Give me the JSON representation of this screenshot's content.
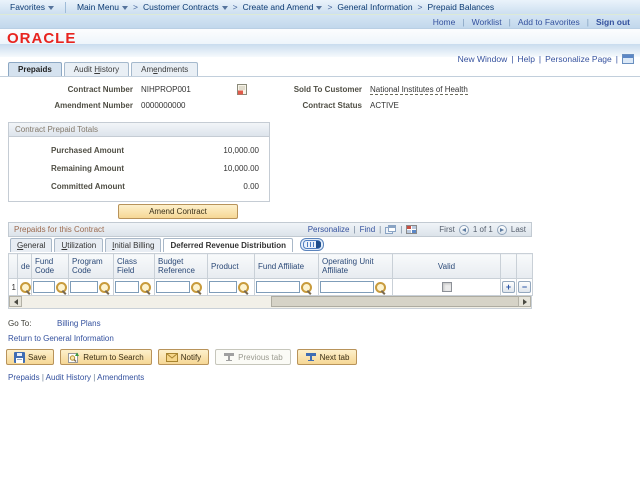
{
  "seps": {
    "pipe": "|",
    "gt": ">"
  },
  "topnav": {
    "favorites": "Favorites",
    "main_menu": "Main Menu",
    "crumbs": [
      "Customer Contracts",
      "Create and Amend",
      "General Information",
      "Prepaid Balances"
    ],
    "quick_links": [
      "Home",
      "Worklist",
      "Add to Favorites",
      "Sign out"
    ]
  },
  "brand": {
    "logo": "ORACLE"
  },
  "page_actions": {
    "links": [
      "New Window",
      "Help",
      "Personalize Page"
    ]
  },
  "page_tabs": {
    "prepaids": "Prepaids",
    "audit_history": {
      "pre": "Audit ",
      "key": "H",
      "post": "istory"
    },
    "amendments": {
      "pre": "Am",
      "key": "e",
      "post": "ndments"
    }
  },
  "fields": {
    "contract_number": {
      "label": "Contract Number",
      "value": "NIHPROP001"
    },
    "amendment_number": {
      "label": "Amendment Number",
      "value": "0000000000"
    },
    "sold_to_customer": {
      "label": "Sold To Customer",
      "value": "National Institutes of Health"
    },
    "contract_status": {
      "label": "Contract Status",
      "value": "ACTIVE"
    }
  },
  "totals": {
    "title": "Contract Prepaid Totals",
    "rows": [
      {
        "label": "Purchased Amount",
        "value": "10,000.00"
      },
      {
        "label": "Remaining Amount",
        "value": "10,000.00"
      },
      {
        "label": "Committed Amount",
        "value": "0.00"
      }
    ]
  },
  "amend_button": "Amend Contract",
  "prepaids_grid": {
    "title": "Prepaids for this Contract",
    "personalize": "Personalize",
    "find": "Find",
    "pagination": {
      "first": "First",
      "counter": "1 of 1",
      "last": "Last"
    },
    "tabs": {
      "general": {
        "key": "G",
        "post": "eneral"
      },
      "utilization": {
        "key": "U",
        "post": "tilization"
      },
      "initial_billing": {
        "key": "I",
        "post": "nitial Billing"
      },
      "deferred": "Deferred Revenue Distribution"
    },
    "columns": [
      "de",
      "Fund Code",
      "Program Code",
      "Class Field",
      "Budget Reference",
      "Product",
      "Fund Affiliate",
      "Operating Unit Affiliate",
      "Valid"
    ],
    "row": {
      "number": "1"
    }
  },
  "footer": {
    "go_to": "Go To:",
    "billing_plans": "Billing Plans",
    "return_link": "Return to General Information",
    "buttons": {
      "save": "Save",
      "return_to_search": "Return to Search",
      "notify": "Notify",
      "previous_tab": "Previous tab",
      "next_tab": "Next tab"
    },
    "links": [
      "Prepaids",
      "Audit History",
      "Amendments"
    ]
  }
}
